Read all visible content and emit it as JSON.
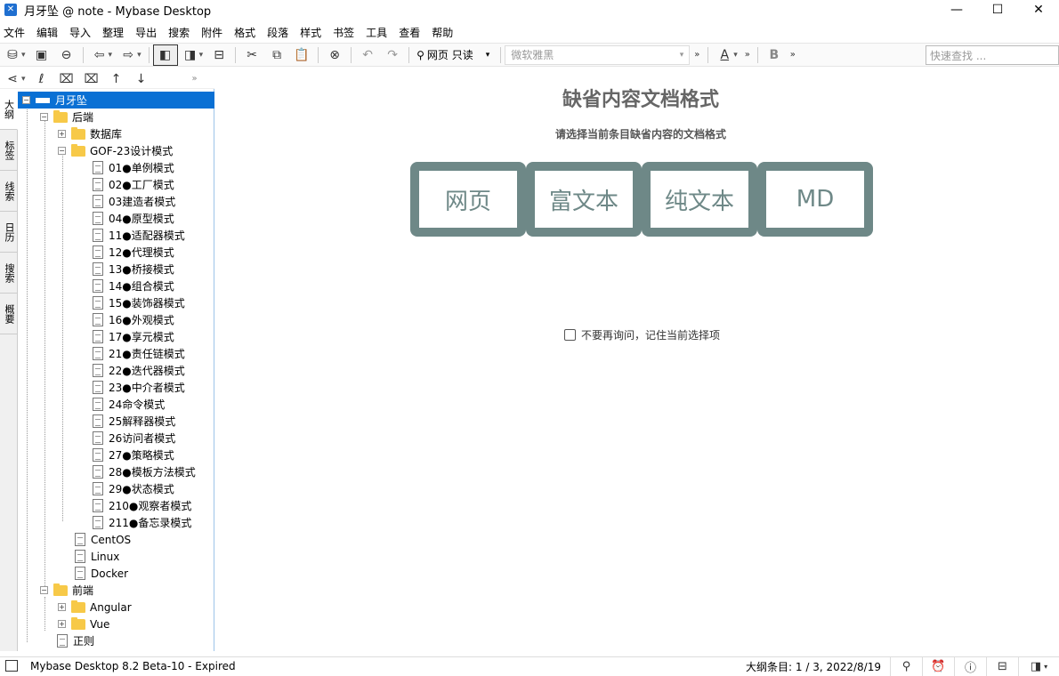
{
  "window": {
    "title": "月牙坠 @ note - Mybase Desktop",
    "app_icon": "x-icon",
    "minimize": "—",
    "maximize": "☐",
    "close": "✕"
  },
  "menu": [
    "文件",
    "编辑",
    "导入",
    "整理",
    "导出",
    "搜索",
    "附件",
    "格式",
    "段落",
    "样式",
    "书签",
    "工具",
    "查看",
    "帮助"
  ],
  "toolbar": {
    "view_mode": "网页 只读",
    "font": "微软雅黑",
    "search_placeholder": "快速查找 ..."
  },
  "left_tabs": [
    "大纲",
    "标签",
    "线索",
    "日历",
    "搜索",
    "概要"
  ],
  "outline": {
    "root": "月牙坠",
    "backend": "后端",
    "database": "数据库",
    "gof": "GOF-23设计模式",
    "patterns": [
      "01●单例模式",
      "02●工厂模式",
      "03建造者模式",
      "04●原型模式",
      "11●适配器模式",
      "12●代理模式",
      "13●桥接模式",
      "14●组合模式",
      "15●装饰器模式",
      "16●外观模式",
      "17●享元模式",
      "21●责任链模式",
      "22●迭代器模式",
      "23●中介者模式",
      "24命令模式",
      "25解释器模式",
      "26访问者模式",
      "27●策略模式",
      "28●模板方法模式",
      "29●状态模式",
      "210●观察者模式",
      "211●备忘录模式"
    ],
    "backend_docs": [
      "CentOS",
      "Linux",
      "Docker"
    ],
    "frontend": "前端",
    "frontend_children": [
      "Angular",
      "Vue"
    ],
    "regex": "正则"
  },
  "content": {
    "title": "缺省内容文档格式",
    "subtitle": "请选择当前条目缺省内容的文档格式",
    "formats": [
      "网页",
      "富文本",
      "纯文本",
      "MD"
    ],
    "remember": "不要再询问，记住当前选择项",
    "accent": "#6e8887"
  },
  "status": {
    "app": "Mybase Desktop 8.2 Beta-10 - Expired",
    "info": "大纲条目: 1 / 3, 2022/8/19"
  }
}
